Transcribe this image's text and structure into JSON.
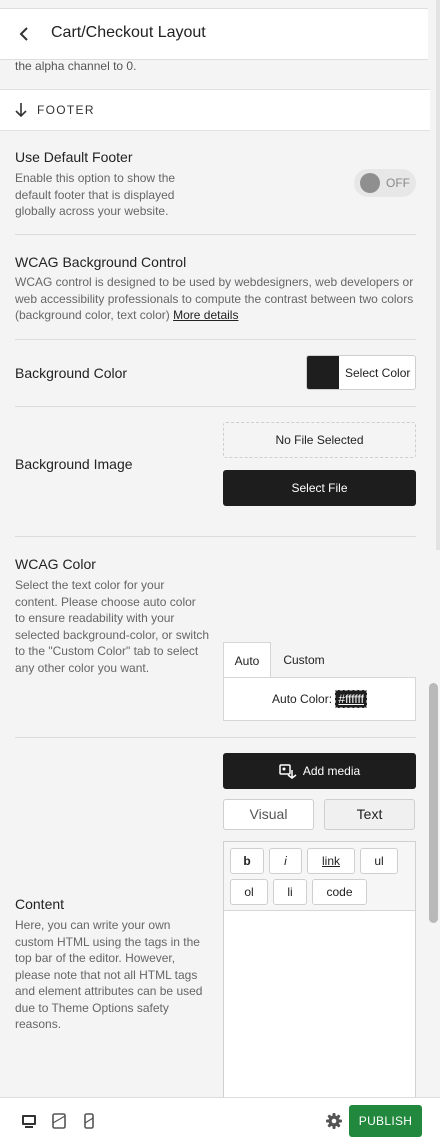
{
  "header": {
    "title": "Cart/Checkout Layout"
  },
  "truncated_note": "the alpha channel to 0.",
  "section_header": {
    "label": "FOOTER"
  },
  "use_default_footer": {
    "title": "Use Default Footer",
    "desc_lines": [
      "Enable this option to show the",
      "default footer that is displayed",
      "globally across your website."
    ],
    "toggle_label": "OFF"
  },
  "wcag_bg_control": {
    "title": "WCAG Background Control",
    "desc_lines": [
      "WCAG control is designed to be used by webdesigners, web developers or",
      "web accessibility professionals to compute the contrast between two colors",
      "(background color, text color)"
    ],
    "more_link": "More details"
  },
  "background_color": {
    "title": "Background Color",
    "swatch": "#1e1e1e",
    "button_label": "Select Color"
  },
  "background_image": {
    "title": "Background Image",
    "file_status": "No File Selected",
    "button_label": "Select File"
  },
  "wcag_color": {
    "title": "WCAG Color",
    "desc_lines": [
      "Select the text color for your",
      "content. Please choose auto color",
      "to ensure readability with your",
      "selected background-color, or switch",
      "to the \"Custom Color\" tab to select",
      "any other color you want."
    ],
    "tabs": [
      "Auto",
      "Custom"
    ],
    "auto_label": "Auto Color:",
    "auto_value": "#ffffff"
  },
  "content": {
    "add_media": "Add media",
    "tab_visual": "Visual",
    "tab_text": "Text",
    "quicktags": [
      "b",
      "i",
      "link",
      "ul",
      "ol",
      "li",
      "code"
    ],
    "title": "Content",
    "desc_lines": [
      "Here, you can write your own",
      "custom HTML using the tags in the",
      "top bar of the editor. However,",
      "please note that not all HTML tags",
      "and element attributes can be used",
      "due to Theme Options safety",
      "reasons."
    ]
  },
  "footer_bar": {
    "publish": "PUBLISH"
  },
  "colors": {
    "publish": "#22883d",
    "dark_button": "#1d1d1d"
  },
  "icons": [
    "back-chevron-icon",
    "arrow-down-icon",
    "add-media-icon",
    "desktop-icon",
    "tablet-icon",
    "mobile-icon",
    "gear-icon"
  ]
}
